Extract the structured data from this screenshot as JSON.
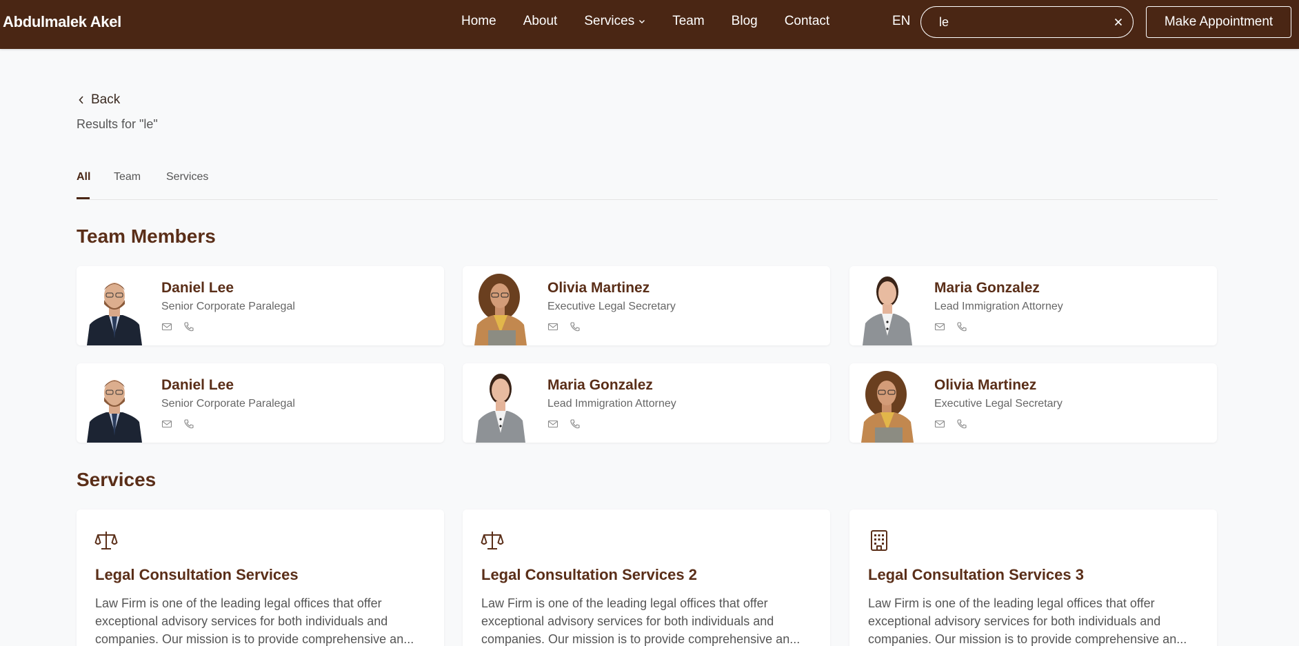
{
  "header": {
    "brand": "Abdulmalek Akel",
    "nav": [
      {
        "label": "Home"
      },
      {
        "label": "About"
      },
      {
        "label": "Services"
      },
      {
        "label": "Team"
      },
      {
        "label": "Blog"
      },
      {
        "label": "Contact"
      }
    ],
    "lang": "EN",
    "search_value": "le",
    "appointment_label": "Make Appointment"
  },
  "page": {
    "back_label": "Back",
    "results_text": "Results for \"le\"",
    "tabs": [
      "All",
      "Team",
      "Services"
    ],
    "active_tab": "All"
  },
  "team": {
    "title": "Team Members",
    "members": [
      {
        "name": "Daniel Lee",
        "role": "Senior Corporate Paralegal"
      },
      {
        "name": "Olivia Martinez",
        "role": "Executive Legal Secretary"
      },
      {
        "name": "Maria Gonzalez",
        "role": "Lead Immigration Attorney"
      },
      {
        "name": "Daniel Lee",
        "role": "Senior Corporate Paralegal"
      },
      {
        "name": "Maria Gonzalez",
        "role": "Lead Immigration Attorney"
      },
      {
        "name": "Olivia Martinez",
        "role": "Executive Legal Secretary"
      }
    ]
  },
  "services": {
    "title": "Services",
    "items": [
      {
        "title": "Legal Consultation Services",
        "icon": "scale-icon",
        "desc": "Law Firm is one of the leading legal offices that offer exceptional advisory services for both individuals and companies. Our mission is to provide comprehensive an..."
      },
      {
        "title": "Legal Consultation Services 2",
        "icon": "scale-icon",
        "desc": "Law Firm is one of the leading legal offices that offer exceptional advisory services for both individuals and companies. Our mission is to provide comprehensive an..."
      },
      {
        "title": "Legal Consultation Services 3",
        "icon": "building-icon",
        "desc": "Law Firm is one of the leading legal offices that offer exceptional advisory services for both individuals and companies. Our mission is to provide comprehensive an..."
      }
    ]
  },
  "colors": {
    "header_bg": "#4a2614",
    "accent": "#5a2e18",
    "page_bg": "#f8f9fa"
  }
}
